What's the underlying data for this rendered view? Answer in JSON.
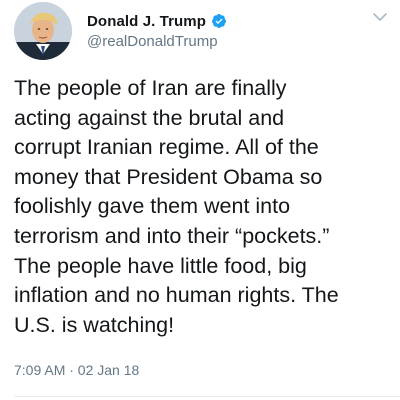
{
  "tweet": {
    "author": {
      "display_name": "Donald J. Trump",
      "handle": "@realDonaldTrump",
      "verified": true,
      "avatar_icon": "profile-photo"
    },
    "text": "The people of Iran are finally\nacting against the brutal and\ncorrupt Iranian regime. All of the\nmoney that President Obama so\nfoolishly gave them went into\nterrorism and into their “pockets.”\nThe people have little food, big\ninflation and no human rights. The\nU.S. is watching!",
    "timestamp": "7:09 AM · 02 Jan 18"
  },
  "icons": {
    "verified": "verified-badge-icon",
    "menu": "chevron-down-icon"
  },
  "colors": {
    "verified_blue": "#1da1f2",
    "text_primary": "#14171a",
    "text_secondary": "#657786"
  }
}
